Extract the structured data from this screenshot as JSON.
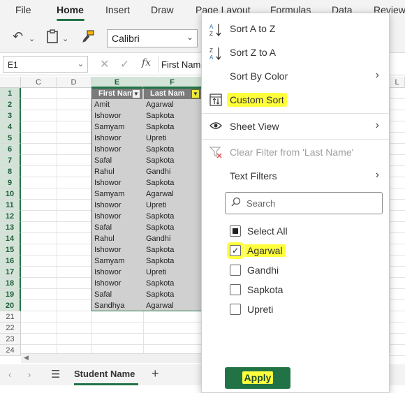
{
  "ribbon": {
    "tabs": [
      "File",
      "Home",
      "Insert",
      "Draw",
      "Page Layout",
      "Formulas",
      "Data",
      "Review"
    ],
    "active_tab": "Home",
    "font_name": "Calibri"
  },
  "formula_bar": {
    "name_box": "E1",
    "fx": "fx",
    "value": "First Nam"
  },
  "grid": {
    "columns": [
      "C",
      "D",
      "E",
      "F",
      "L"
    ],
    "rows": [
      "1",
      "2",
      "3",
      "4",
      "5",
      "6",
      "7",
      "8",
      "9",
      "10",
      "11",
      "12",
      "13",
      "14",
      "15",
      "16",
      "17",
      "18",
      "19",
      "20",
      "21",
      "22",
      "23",
      "24"
    ],
    "header": [
      "First Nam",
      "Last Nam"
    ],
    "data": [
      [
        "Amit",
        "Agarwal"
      ],
      [
        "Ishowor",
        "Sapkota"
      ],
      [
        "Samyam",
        "Sapkota"
      ],
      [
        "Ishowor",
        "Upreti"
      ],
      [
        "Ishowor",
        "Sapkota"
      ],
      [
        "Safal",
        "Sapkota"
      ],
      [
        "Rahul",
        "Gandhi"
      ],
      [
        "Ishowor",
        "Sapkota"
      ],
      [
        "Samyam",
        "Agarwal"
      ],
      [
        "Ishowor",
        "Upreti"
      ],
      [
        "Ishowor",
        "Sapkota"
      ],
      [
        "Safal",
        "Sapkota"
      ],
      [
        "Rahul",
        "Gandhi"
      ],
      [
        "Ishowor",
        "Sapkota"
      ],
      [
        "Samyam",
        "Sapkota"
      ],
      [
        "Ishowor",
        "Upreti"
      ],
      [
        "Ishowor",
        "Sapkota"
      ],
      [
        "Safal",
        "Sapkota"
      ],
      [
        "Sandhya",
        "Agarwal"
      ]
    ]
  },
  "sheet": {
    "tab_name": "Student Name",
    "add": "+",
    "menu": "☰"
  },
  "filter_menu": {
    "sort_asc": "Sort A to Z",
    "sort_desc": "Sort Z to A",
    "sort_color": "Sort By Color",
    "custom_sort": "Custom Sort",
    "sheet_view": "Sheet View",
    "clear_filter": "Clear Filter from 'Last Name'",
    "text_filters": "Text Filters",
    "search_placeholder": "Search",
    "select_all": "Select All",
    "options": [
      {
        "label": "Agarwal",
        "checked": true
      },
      {
        "label": "Gandhi",
        "checked": false
      },
      {
        "label": "Sapkota",
        "checked": false
      },
      {
        "label": "Upreti",
        "checked": false
      }
    ],
    "apply": "Apply",
    "highlight_color": "#ffff3c",
    "accent_color": "#217346"
  }
}
